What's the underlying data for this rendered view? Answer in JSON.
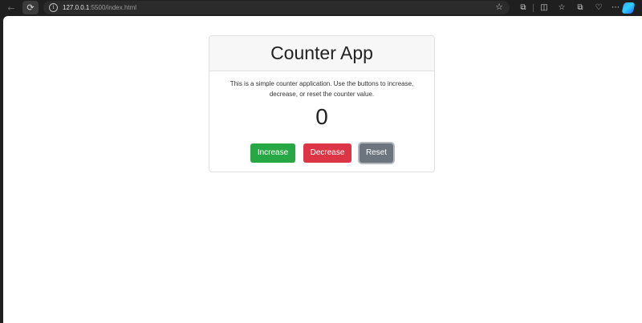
{
  "browser": {
    "address": {
      "host": "127.0.0.1",
      "path": ":5500/index.html"
    },
    "icons": {
      "back": "arrow-left-icon",
      "refresh": "refresh-icon",
      "info": "info-icon",
      "favorite": "star-icon",
      "extensions": [
        "extensions-icon",
        "split-screen-icon",
        "favorites-icon",
        "collections-icon",
        "browser-essentials-icon",
        "more-icon",
        "copilot-icon"
      ]
    }
  },
  "app": {
    "title": "Counter App",
    "description": "This is a simple counter application. Use the buttons to increase, decrease, or reset the counter value.",
    "count": "0",
    "buttons": {
      "increase": "Increase",
      "decrease": "Decrease",
      "reset": "Reset"
    }
  },
  "colors": {
    "increase": "#28a745",
    "decrease": "#dc3545",
    "reset": "#6c757d"
  }
}
